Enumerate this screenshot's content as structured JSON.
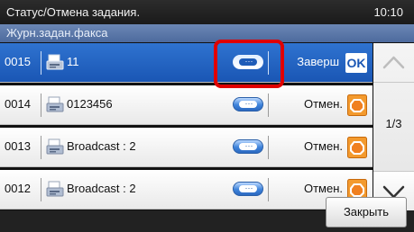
{
  "header": {
    "title": "Статус/Отмена задания.",
    "time": "10:10"
  },
  "subheader": {
    "title": "Журн.задан.факса"
  },
  "jobs": [
    {
      "number": "0015",
      "destination": "11",
      "status": "Заверш",
      "status_icon": "ok-icon",
      "status_badge": "OK",
      "selected": true
    },
    {
      "number": "0014",
      "destination": "0123456",
      "status": "Отмен.",
      "status_icon": "stop-icon",
      "selected": false
    },
    {
      "number": "0013",
      "destination": "Broadcast : 2",
      "status": "Отмен.",
      "status_icon": "stop-icon",
      "selected": false
    },
    {
      "number": "0012",
      "destination": "Broadcast : 2",
      "status": "Отмен.",
      "status_icon": "stop-icon",
      "selected": false
    }
  ],
  "detail_button_label": "···",
  "pagination": {
    "indicator": "1/3"
  },
  "footer": {
    "close_label": "Закрыть"
  },
  "colors": {
    "selected_row": "#1f5cb8",
    "highlight_frame": "#e00000",
    "subheader": "#5a76a8",
    "stop_icon": "#f08020"
  }
}
